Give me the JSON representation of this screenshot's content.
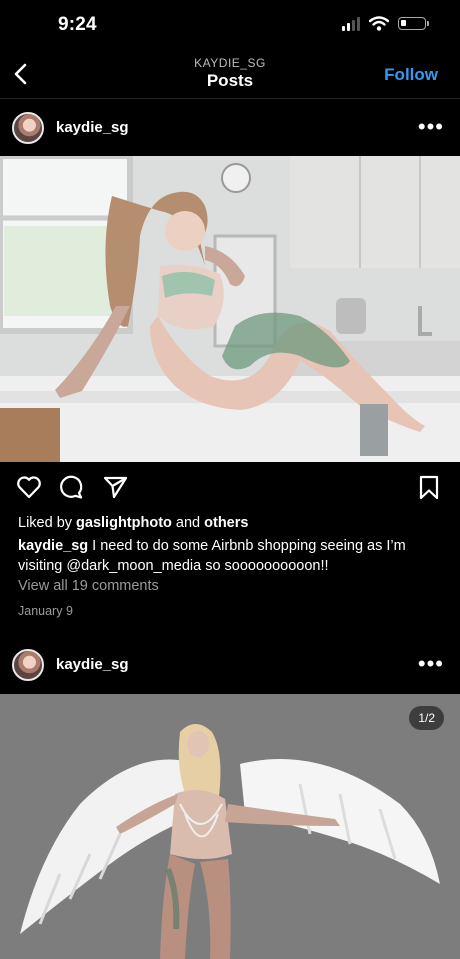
{
  "status_bar": {
    "time": "9:24"
  },
  "nav": {
    "subtitle": "KAYDIE_SG",
    "title": "Posts",
    "follow_label": "Follow"
  },
  "posts": [
    {
      "username": "kaydie_sg",
      "liked_prefix": "Liked by ",
      "liked_user": "gaslightphoto",
      "liked_and": " and ",
      "liked_others": "others",
      "caption_user": "kaydie_sg",
      "caption_text": " I need to do some Airbnb shopping seeing as I’m visiting @dark_moon_media so soooooooooon!!",
      "comments_label": "View all 19 comments",
      "date": "January 9"
    },
    {
      "username": "kaydie_sg",
      "image_counter": "1/2"
    }
  ],
  "colors": {
    "accent": "#3897f0",
    "background": "#000000"
  },
  "icons": [
    "back-chevron-icon",
    "more-options-icon",
    "heart-icon",
    "comment-icon",
    "share-icon",
    "bookmark-icon",
    "wifi-icon",
    "signal-icon",
    "battery-icon"
  ]
}
